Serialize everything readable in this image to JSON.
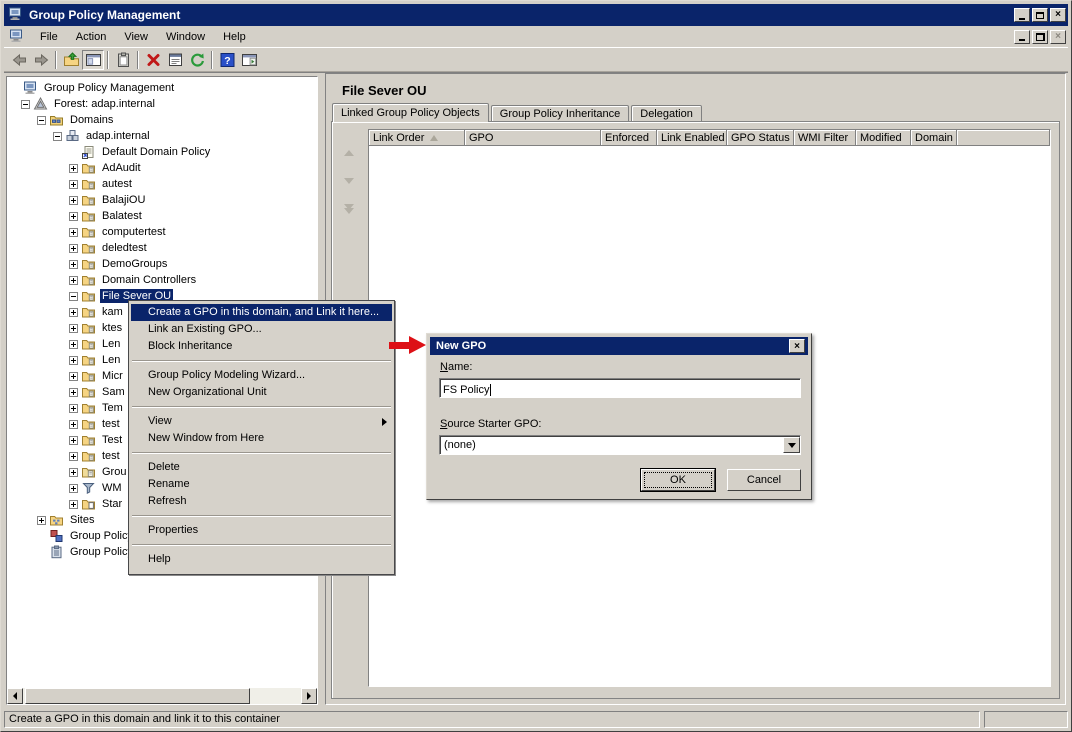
{
  "window": {
    "title": "Group Policy Management",
    "controls": [
      "minimize",
      "maximize",
      "close"
    ]
  },
  "menu_bar": {
    "items": [
      "File",
      "Action",
      "View",
      "Window",
      "Help"
    ],
    "mdi_controls": [
      "minimize",
      "restore",
      "close"
    ]
  },
  "toolbar": {
    "buttons": [
      {
        "name": "back"
      },
      {
        "name": "forward"
      },
      {
        "sep": true
      },
      {
        "name": "up-folder"
      },
      {
        "name": "console-tree",
        "pressed": true
      },
      {
        "sep": true
      },
      {
        "name": "clipboard"
      },
      {
        "sep": true
      },
      {
        "name": "delete"
      },
      {
        "name": "properties"
      },
      {
        "name": "refresh"
      },
      {
        "sep": true
      },
      {
        "name": "help"
      },
      {
        "name": "action-pane"
      }
    ]
  },
  "tree": {
    "items": [
      {
        "label": "Group Policy Management",
        "depth": 0,
        "exp": "none",
        "icon": "console"
      },
      {
        "label": "Forest: adap.internal",
        "depth": 1,
        "exp": "minus",
        "icon": "forest"
      },
      {
        "label": "Domains",
        "depth": 2,
        "exp": "minus",
        "icon": "domains"
      },
      {
        "label": "adap.internal",
        "depth": 3,
        "exp": "minus",
        "icon": "domain"
      },
      {
        "label": "Default Domain Policy",
        "depth": 4,
        "exp": "none",
        "icon": "gpo-link"
      },
      {
        "label": "AdAudit",
        "depth": 4,
        "exp": "plus",
        "icon": "ou"
      },
      {
        "label": "autest",
        "depth": 4,
        "exp": "plus",
        "icon": "ou"
      },
      {
        "label": "BalajiOU",
        "depth": 4,
        "exp": "plus",
        "icon": "ou"
      },
      {
        "label": "Balatest",
        "depth": 4,
        "exp": "plus",
        "icon": "ou"
      },
      {
        "label": "computertest",
        "depth": 4,
        "exp": "plus",
        "icon": "ou"
      },
      {
        "label": "deledtest",
        "depth": 4,
        "exp": "plus",
        "icon": "ou"
      },
      {
        "label": "DemoGroups",
        "depth": 4,
        "exp": "plus",
        "icon": "ou"
      },
      {
        "label": "Domain Controllers",
        "depth": 4,
        "exp": "plus",
        "icon": "ou"
      },
      {
        "label": "File Sever OU",
        "depth": 4,
        "exp": "minus",
        "icon": "ou",
        "selected": true
      },
      {
        "label": "kam",
        "depth": 4,
        "exp": "plus",
        "icon": "ou"
      },
      {
        "label": "ktes",
        "depth": 4,
        "exp": "plus",
        "icon": "ou"
      },
      {
        "label": "Len",
        "depth": 4,
        "exp": "plus",
        "icon": "ou"
      },
      {
        "label": "Len",
        "depth": 4,
        "exp": "plus",
        "icon": "ou"
      },
      {
        "label": "Micr",
        "depth": 4,
        "exp": "plus",
        "icon": "ou"
      },
      {
        "label": "Sam",
        "depth": 4,
        "exp": "plus",
        "icon": "ou"
      },
      {
        "label": "Tem",
        "depth": 4,
        "exp": "plus",
        "icon": "ou"
      },
      {
        "label": "test",
        "depth": 4,
        "exp": "plus",
        "icon": "ou"
      },
      {
        "label": "Test",
        "depth": 4,
        "exp": "plus",
        "icon": "ou"
      },
      {
        "label": "test",
        "depth": 4,
        "exp": "plus",
        "icon": "ou"
      },
      {
        "label": "Grou",
        "depth": 4,
        "exp": "plus",
        "icon": "gpo-folder"
      },
      {
        "label": "WM",
        "depth": 4,
        "exp": "plus",
        "icon": "wmi-filter"
      },
      {
        "label": "Star",
        "depth": 4,
        "exp": "plus",
        "icon": "starter"
      },
      {
        "label": "Sites",
        "depth": 2,
        "exp": "plus",
        "icon": "sites"
      },
      {
        "label": "Group Policy",
        "depth": 2,
        "exp": "none",
        "icon": "modeling"
      },
      {
        "label": "Group Policy",
        "depth": 2,
        "exp": "none",
        "icon": "results"
      }
    ]
  },
  "context_menu": {
    "items": [
      {
        "label": "Create a GPO in this domain, and Link it here...",
        "highlighted": true
      },
      {
        "label": "Link an Existing GPO..."
      },
      {
        "label": "Block Inheritance"
      },
      {
        "sep": true
      },
      {
        "label": "Group Policy Modeling Wizard..."
      },
      {
        "label": "New Organizational Unit"
      },
      {
        "sep": true
      },
      {
        "label": "View",
        "submenu": true
      },
      {
        "label": "New Window from Here"
      },
      {
        "sep": true
      },
      {
        "label": "Delete"
      },
      {
        "label": "Rename"
      },
      {
        "label": "Refresh"
      },
      {
        "sep": true
      },
      {
        "label": "Properties"
      },
      {
        "sep": true
      },
      {
        "label": "Help"
      }
    ]
  },
  "right_panel": {
    "title": "File Sever OU",
    "tabs": [
      {
        "label": "Linked Group Policy Objects",
        "active": true
      },
      {
        "label": "Group Policy Inheritance"
      },
      {
        "label": "Delegation"
      }
    ],
    "list": {
      "columns": [
        {
          "label": "Link Order",
          "sort": "asc"
        },
        {
          "label": "GPO"
        },
        {
          "label": "Enforced"
        },
        {
          "label": "Link Enabled"
        },
        {
          "label": "GPO Status"
        },
        {
          "label": "WMI Filter"
        },
        {
          "label": "Modified"
        },
        {
          "label": "Domain"
        }
      ],
      "rows": []
    },
    "link_order_buttons": [
      "move-up",
      "move-down",
      "move-bottom"
    ]
  },
  "dialog": {
    "title": "New GPO",
    "name_label": "Name:",
    "name_value": "FS Policy",
    "source_label": "Source Starter GPO:",
    "source_value": "(none)",
    "ok_label": "OK",
    "cancel_label": "Cancel"
  },
  "status_bar": {
    "text": "Create a GPO in this domain and link it to this container"
  },
  "colors": {
    "titlebar": "#0a246a",
    "selection": "#0a246a",
    "base": "#d4d0c8",
    "annotation_arrow": "#dd1016"
  }
}
